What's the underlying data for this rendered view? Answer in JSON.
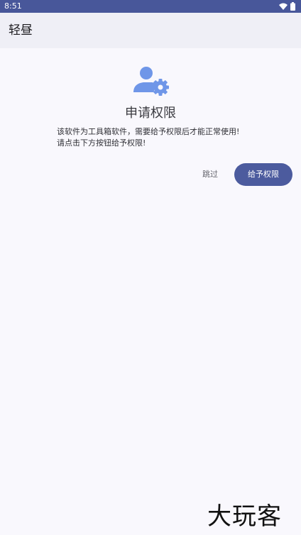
{
  "status_bar": {
    "time": "8:51",
    "icons": [
      "wifi-icon",
      "battery-icon"
    ]
  },
  "app_bar": {
    "title": "轻昼"
  },
  "permission": {
    "icon": "user-settings-icon",
    "title": "申请权限",
    "desc_line1": "该软件为工具箱软件，需要给予权限后才能正常使用!",
    "desc_line2": "请点击下方按钮给予权限!"
  },
  "actions": {
    "skip_label": "跳过",
    "grant_label": "给予权限"
  },
  "watermark": {
    "text": "大玩客"
  },
  "colors": {
    "status_bar": "#48579a",
    "app_bar": "#efeff6",
    "background": "#f9f8fd",
    "accent": "#4c5b9e",
    "icon": "#6f96e8"
  }
}
